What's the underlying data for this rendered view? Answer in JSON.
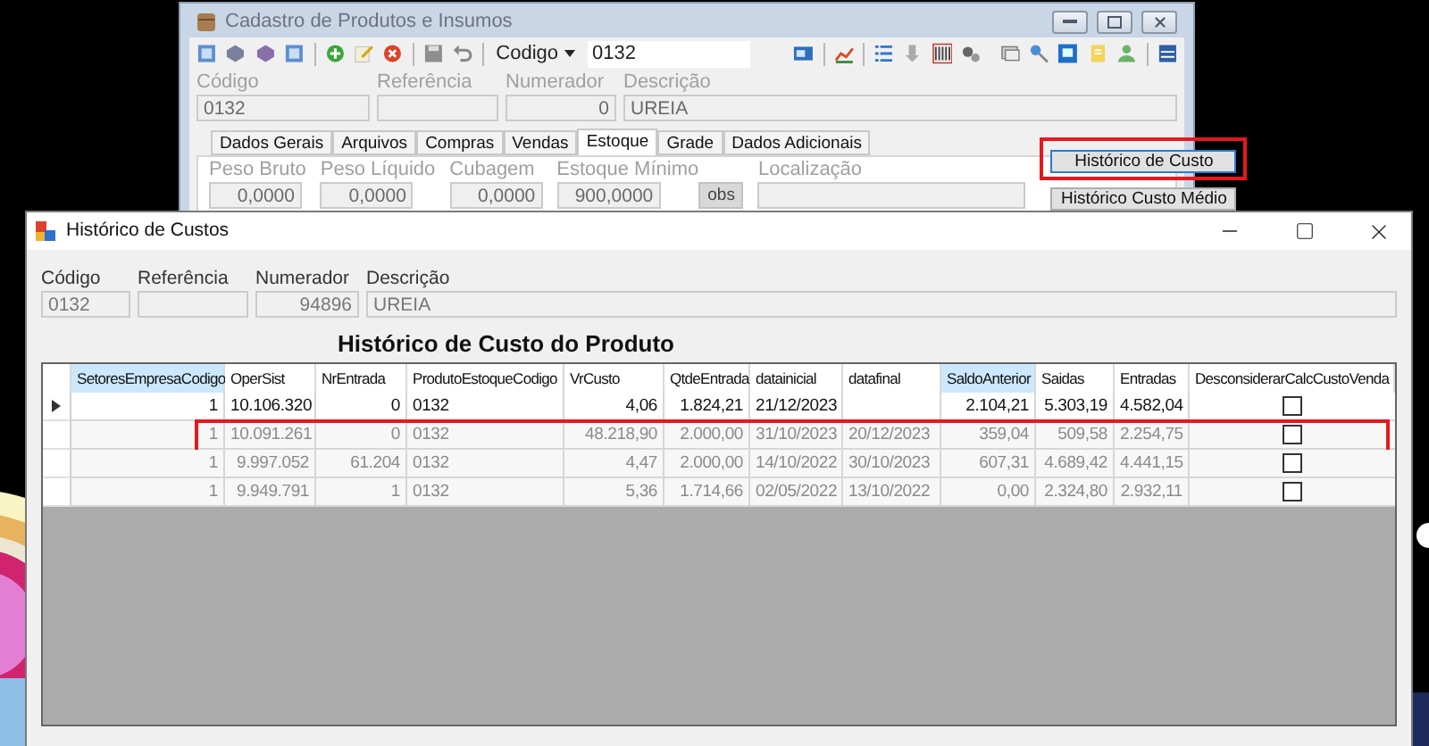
{
  "background_window": {
    "title": "Cadastro de Produtos e Insumos",
    "search_by": "Codigo",
    "search_value": "0132",
    "fields": [
      {
        "label": "Código",
        "value": "0132",
        "kind": "text"
      },
      {
        "label": "Referência",
        "kind": "text"
      },
      {
        "label": "Numerador",
        "value": "0",
        "kind": "number"
      },
      {
        "label": "Descrição",
        "value": "UREIA",
        "kind": "text"
      }
    ],
    "tabs": [
      {
        "label": "Dados Gerais",
        "selected": false
      },
      {
        "label": "Arquivos",
        "selected": false
      },
      {
        "label": "Compras",
        "selected": false
      },
      {
        "label": "Vendas",
        "selected": false
      },
      {
        "label": "Estoque",
        "selected": true
      },
      {
        "label": "Grade",
        "selected": false
      },
      {
        "label": "Dados Adicionais",
        "selected": false
      }
    ],
    "stock_fields": [
      {
        "label": "Peso Bruto",
        "value": "0,0000"
      },
      {
        "label": "Peso Líquido",
        "value": "0,0000"
      },
      {
        "label": "Cubagem",
        "value": "0,0000"
      },
      {
        "label": "Estoque Mínimo",
        "value": "900,0000"
      }
    ],
    "obs_button": "obs",
    "location_label": "Localização",
    "buttons": [
      {
        "label": "Histórico de Custo",
        "highlighted": true
      },
      {
        "label": "Histórico Custo Médio",
        "highlighted": false
      }
    ]
  },
  "dialog": {
    "title": "Histórico de Custos",
    "fields": [
      {
        "label": "Código",
        "value": "0132",
        "kind": "text"
      },
      {
        "label": "Referência",
        "kind": "text"
      },
      {
        "label": "Numerador",
        "value": "94896",
        "kind": "number"
      },
      {
        "label": "Descrição",
        "value": "UREIA",
        "kind": "text"
      }
    ],
    "heading": "Histórico de Custo do Produto",
    "table": {
      "columns": [
        {
          "label": "SetoresEmpresaCodigo",
          "kind": "number",
          "selected": true
        },
        {
          "label": "OperSist",
          "kind": "number",
          "selected": false
        },
        {
          "label": "NrEntrada",
          "kind": "number",
          "selected": false
        },
        {
          "label": "ProdutoEstoqueCodigo",
          "kind": "text",
          "selected": false
        },
        {
          "label": "VrCusto",
          "kind": "number",
          "selected": false
        },
        {
          "label": "QtdeEntrada",
          "kind": "number",
          "selected": false
        },
        {
          "label": "datainicial",
          "kind": "text",
          "selected": false
        },
        {
          "label": "datafinal",
          "kind": "text",
          "selected": false
        },
        {
          "label": "SaldoAnterior",
          "kind": "number",
          "selected": true
        },
        {
          "label": "Saidas",
          "kind": "number",
          "selected": false
        },
        {
          "label": "Entradas",
          "kind": "number",
          "selected": false
        },
        {
          "label": "DesconsiderarCalcCustoVenda",
          "kind": "checkbox",
          "selected": false
        }
      ],
      "rows": [
        {
          "current": true,
          "highlighted": false,
          "cells": [
            "1",
            "10.106.320",
            "0",
            "0132",
            "4,06",
            "1.824,21",
            "21/12/2023",
            null,
            "2.104,21",
            "5.303,19",
            "4.582,04"
          ],
          "checked": false
        },
        {
          "current": false,
          "highlighted": true,
          "cells": [
            "1",
            "10.091.261",
            "0",
            "0132",
            "48.218,90",
            "2.000,00",
            "31/10/2023",
            "20/12/2023",
            "359,04",
            "509,58",
            "2.254,75"
          ],
          "checked": false
        },
        {
          "current": false,
          "highlighted": false,
          "cells": [
            "1",
            "9.997.052",
            "61.204",
            "0132",
            "4,47",
            "2.000,00",
            "14/10/2022",
            "30/10/2023",
            "607,31",
            "4.689,42",
            "4.441,15"
          ],
          "checked": false
        },
        {
          "current": false,
          "highlighted": false,
          "cells": [
            "1",
            "9.949.791",
            "1",
            "0132",
            "5,36",
            "1.714,66",
            "02/05/2022",
            "13/10/2022",
            "0,00",
            "2.324,80",
            "2.932,11"
          ],
          "checked": false
        }
      ]
    }
  }
}
